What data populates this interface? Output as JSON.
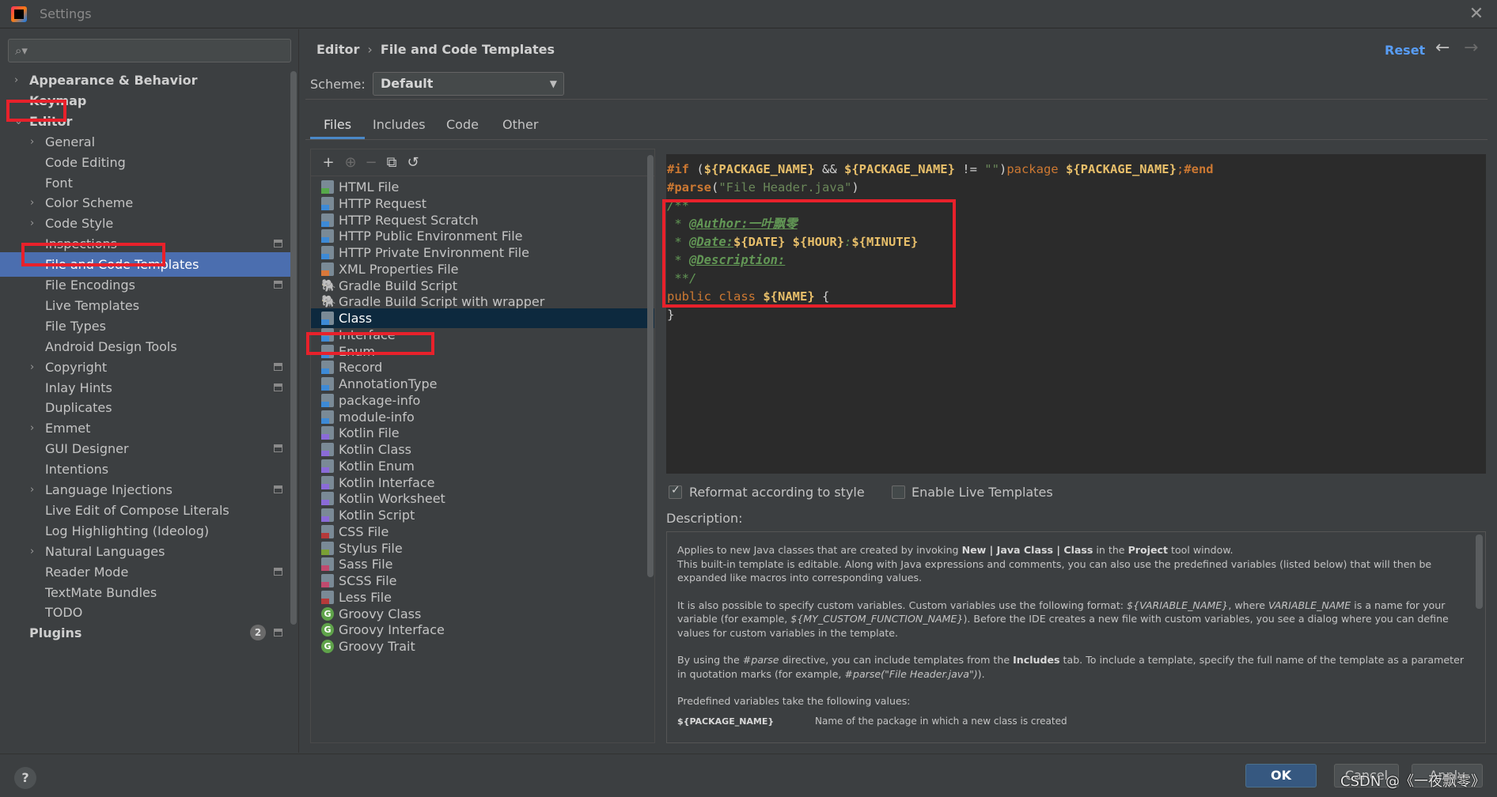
{
  "window": {
    "title": "Settings"
  },
  "search": {
    "placeholder": ""
  },
  "sidebar": {
    "items": [
      {
        "label": "Appearance & Behavior",
        "level": 0,
        "chevron": "›",
        "name": "sidebar-item-appearance-behavior"
      },
      {
        "label": "Keymap",
        "level": 0,
        "chevron": "",
        "name": "sidebar-item-keymap"
      },
      {
        "label": "Editor",
        "level": 0,
        "chevron": "⌄",
        "name": "sidebar-item-editor"
      },
      {
        "label": "General",
        "level": 1,
        "chevron": "›",
        "name": "sidebar-item-general"
      },
      {
        "label": "Code Editing",
        "level": 1,
        "chevron": "",
        "name": "sidebar-item-code-editing"
      },
      {
        "label": "Font",
        "level": 1,
        "chevron": "",
        "name": "sidebar-item-font"
      },
      {
        "label": "Color Scheme",
        "level": 1,
        "chevron": "›",
        "name": "sidebar-item-color-scheme"
      },
      {
        "label": "Code Style",
        "level": 1,
        "chevron": "›",
        "name": "sidebar-item-code-style"
      },
      {
        "label": "Inspections",
        "level": 1,
        "chevron": "",
        "proj": true,
        "name": "sidebar-item-inspections"
      },
      {
        "label": "File and Code Templates",
        "level": 1,
        "chevron": "",
        "selected": true,
        "name": "sidebar-item-file-and-code-templates"
      },
      {
        "label": "File Encodings",
        "level": 1,
        "chevron": "",
        "proj": true,
        "name": "sidebar-item-file-encodings"
      },
      {
        "label": "Live Templates",
        "level": 1,
        "chevron": "",
        "name": "sidebar-item-live-templates"
      },
      {
        "label": "File Types",
        "level": 1,
        "chevron": "",
        "name": "sidebar-item-file-types"
      },
      {
        "label": "Android Design Tools",
        "level": 1,
        "chevron": "",
        "name": "sidebar-item-android-design-tools"
      },
      {
        "label": "Copyright",
        "level": 1,
        "chevron": "›",
        "proj": true,
        "name": "sidebar-item-copyright"
      },
      {
        "label": "Inlay Hints",
        "level": 1,
        "chevron": "",
        "proj": true,
        "name": "sidebar-item-inlay-hints"
      },
      {
        "label": "Duplicates",
        "level": 1,
        "chevron": "",
        "name": "sidebar-item-duplicates"
      },
      {
        "label": "Emmet",
        "level": 1,
        "chevron": "›",
        "name": "sidebar-item-emmet"
      },
      {
        "label": "GUI Designer",
        "level": 1,
        "chevron": "",
        "proj": true,
        "name": "sidebar-item-gui-designer"
      },
      {
        "label": "Intentions",
        "level": 1,
        "chevron": "",
        "name": "sidebar-item-intentions"
      },
      {
        "label": "Language Injections",
        "level": 1,
        "chevron": "›",
        "proj": true,
        "name": "sidebar-item-language-injections"
      },
      {
        "label": "Live Edit of Compose Literals",
        "level": 1,
        "chevron": "",
        "name": "sidebar-item-live-edit-compose"
      },
      {
        "label": "Log Highlighting (Ideolog)",
        "level": 1,
        "chevron": "",
        "name": "sidebar-item-log-highlighting"
      },
      {
        "label": "Natural Languages",
        "level": 1,
        "chevron": "›",
        "name": "sidebar-item-natural-languages"
      },
      {
        "label": "Reader Mode",
        "level": 1,
        "chevron": "",
        "proj": true,
        "name": "sidebar-item-reader-mode"
      },
      {
        "label": "TextMate Bundles",
        "level": 1,
        "chevron": "",
        "name": "sidebar-item-textmate-bundles"
      },
      {
        "label": "TODO",
        "level": 1,
        "chevron": "",
        "name": "sidebar-item-todo"
      },
      {
        "label": "Plugins",
        "level": 0,
        "chevron": "",
        "badge": "2",
        "proj": true,
        "name": "sidebar-item-plugins"
      }
    ]
  },
  "header": {
    "breadcrumb": [
      "Editor",
      "File and Code Templates"
    ],
    "reset_label": "Reset",
    "back_icon": "←",
    "forward_icon": "→"
  },
  "scheme": {
    "label": "Scheme:",
    "value": "Default"
  },
  "tabs": [
    "Files",
    "Includes",
    "Code",
    "Other"
  ],
  "toolbar": {
    "add": "+",
    "add_child": "⊕",
    "remove": "−",
    "copy": "⧉",
    "revert": "↺"
  },
  "templates": [
    {
      "label": "HTML File",
      "icon": "html"
    },
    {
      "label": "HTTP Request",
      "icon": "http"
    },
    {
      "label": "HTTP Request Scratch",
      "icon": "http"
    },
    {
      "label": "HTTP Public Environment File",
      "icon": "http"
    },
    {
      "label": "HTTP Private Environment File",
      "icon": "http"
    },
    {
      "label": "XML Properties File",
      "icon": "xml"
    },
    {
      "label": "Gradle Build Script",
      "icon": "gradle"
    },
    {
      "label": "Gradle Build Script with wrapper",
      "icon": "gradle"
    },
    {
      "label": "Class",
      "icon": "java",
      "selected": true
    },
    {
      "label": "Interface",
      "icon": "java"
    },
    {
      "label": "Enum",
      "icon": "java"
    },
    {
      "label": "Record",
      "icon": "java"
    },
    {
      "label": "AnnotationType",
      "icon": "java"
    },
    {
      "label": "package-info",
      "icon": "java"
    },
    {
      "label": "module-info",
      "icon": "java"
    },
    {
      "label": "Kotlin File",
      "icon": "kotlin"
    },
    {
      "label": "Kotlin Class",
      "icon": "kotlin"
    },
    {
      "label": "Kotlin Enum",
      "icon": "kotlin"
    },
    {
      "label": "Kotlin Interface",
      "icon": "kotlin"
    },
    {
      "label": "Kotlin Worksheet",
      "icon": "kotlin"
    },
    {
      "label": "Kotlin Script",
      "icon": "kotlin"
    },
    {
      "label": "CSS File",
      "icon": "css"
    },
    {
      "label": "Stylus File",
      "icon": "styl"
    },
    {
      "label": "Sass File",
      "icon": "sass"
    },
    {
      "label": "SCSS File",
      "icon": "sass"
    },
    {
      "label": "Less File",
      "icon": "css"
    },
    {
      "label": "Groovy Class",
      "icon": "groovy"
    },
    {
      "label": "Groovy Interface",
      "icon": "groovy"
    },
    {
      "label": "Groovy Trait",
      "icon": "groovy"
    }
  ],
  "editor": {
    "lines": [
      [
        [
          "kw",
          "#if"
        ],
        [
          "white",
          " ("
        ],
        [
          "var",
          "${PACKAGE_NAME}"
        ],
        [
          "white",
          " && "
        ],
        [
          "var",
          "${PACKAGE_NAME}"
        ],
        [
          "white",
          " != "
        ],
        [
          "strl",
          "\"\""
        ],
        [
          "white",
          ")"
        ],
        [
          "kw2",
          "package "
        ],
        [
          "var",
          "${PACKAGE_NAME}"
        ],
        [
          "kw2",
          ";"
        ],
        [
          "kw",
          "#end"
        ]
      ],
      [
        [
          "kw",
          "#parse"
        ],
        [
          "white",
          "("
        ],
        [
          "strl",
          "\"File Header.java\""
        ],
        [
          "white",
          ")"
        ]
      ],
      [
        [
          "cm",
          "/**"
        ]
      ],
      [
        [
          "cm",
          " * "
        ],
        [
          "tag",
          "@Author:一叶飘零"
        ]
      ],
      [
        [
          "cm",
          " * "
        ],
        [
          "tag",
          "@Date:"
        ],
        [
          "var",
          "${DATE}"
        ],
        [
          "white",
          " "
        ],
        [
          "var",
          "${HOUR}"
        ],
        [
          "cm",
          ":"
        ],
        [
          "var",
          "${MINUTE}"
        ]
      ],
      [
        [
          "cm",
          " * "
        ],
        [
          "tag",
          "@Description:"
        ]
      ],
      [
        [
          "cm",
          " **/"
        ]
      ],
      [
        [
          "kw2",
          "public class "
        ],
        [
          "var",
          "${NAME}"
        ],
        [
          "white",
          " {"
        ]
      ],
      [
        [
          "white",
          "}"
        ]
      ]
    ]
  },
  "options": {
    "reformat": {
      "label": "Reformat according to style",
      "checked": true
    },
    "live_templates": {
      "label": "Enable Live Templates",
      "checked": false
    }
  },
  "description": {
    "heading": "Description:",
    "p1_a": "Applies to new Java classes that are created by invoking ",
    "p1_b": "New | Java Class | Class",
    "p1_c": " in the ",
    "p1_d": "Project",
    "p1_e": " tool window.",
    "p1_f": "This built-in template is editable. Along with Java expressions and comments, you can also use the predefined variables (listed below) that will then be expanded like macros into corresponding values.",
    "p2_a": "It is also possible to specify custom variables. Custom variables use the following format: ",
    "p2_b": "${VARIABLE_NAME}",
    "p2_c": ", where ",
    "p2_d": "VARIABLE_NAME",
    "p2_e": " is a name for your variable (for example, ",
    "p2_f": "${MY_CUSTOM_FUNCTION_NAME}",
    "p2_g": "). Before the IDE creates a new file with custom variables, you see a dialog where you can define values for custom variables in the template.",
    "p3_a": "By using the ",
    "p3_b": "#parse",
    "p3_c": " directive, you can include templates from the ",
    "p3_d": "Includes",
    "p3_e": " tab. To include a template, specify the full name of the template as a parameter in quotation marks (for example, ",
    "p3_f": "#parse(\"File Header.java\")",
    "p3_g": ").",
    "p4": "Predefined variables take the following values:",
    "var_name": "${PACKAGE_NAME}",
    "var_desc": "Name of the package in which a new class is created"
  },
  "buttons": {
    "help": "?",
    "ok": "OK",
    "cancel": "Cancel",
    "apply": "Apply"
  },
  "watermark": "CSDN @《一夜飘零》"
}
